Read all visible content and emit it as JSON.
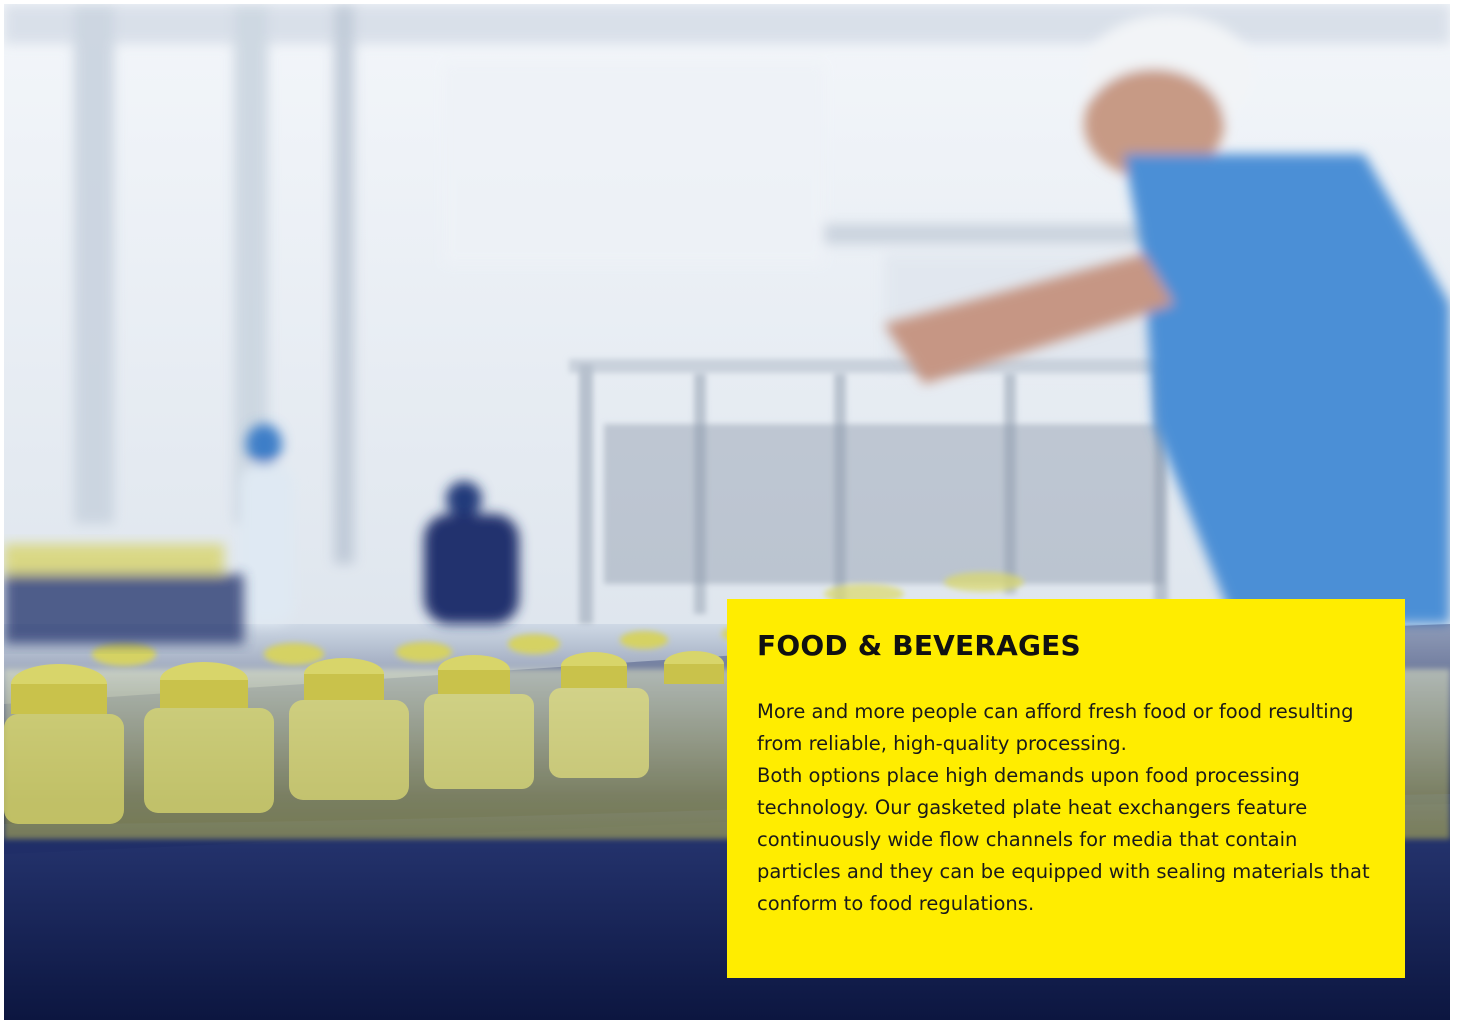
{
  "hero": {
    "image_alt": "Beverage bottling line with yellow-capped bottles on a conveyor and workers in a factory",
    "accent_color": "#ffed00"
  },
  "card": {
    "title": "FOOD & BEVERAGES",
    "paragraph_1": "More and more people can afford fresh food or food resulting from reliable, high-quality processing.",
    "paragraph_2": "Both options place high demands upon food processing technology. Our gasketed plate heat exchangers feature continuously wide flow channels for media that contain particles and they can be equipped with sealing materials that conform to food regulations."
  }
}
